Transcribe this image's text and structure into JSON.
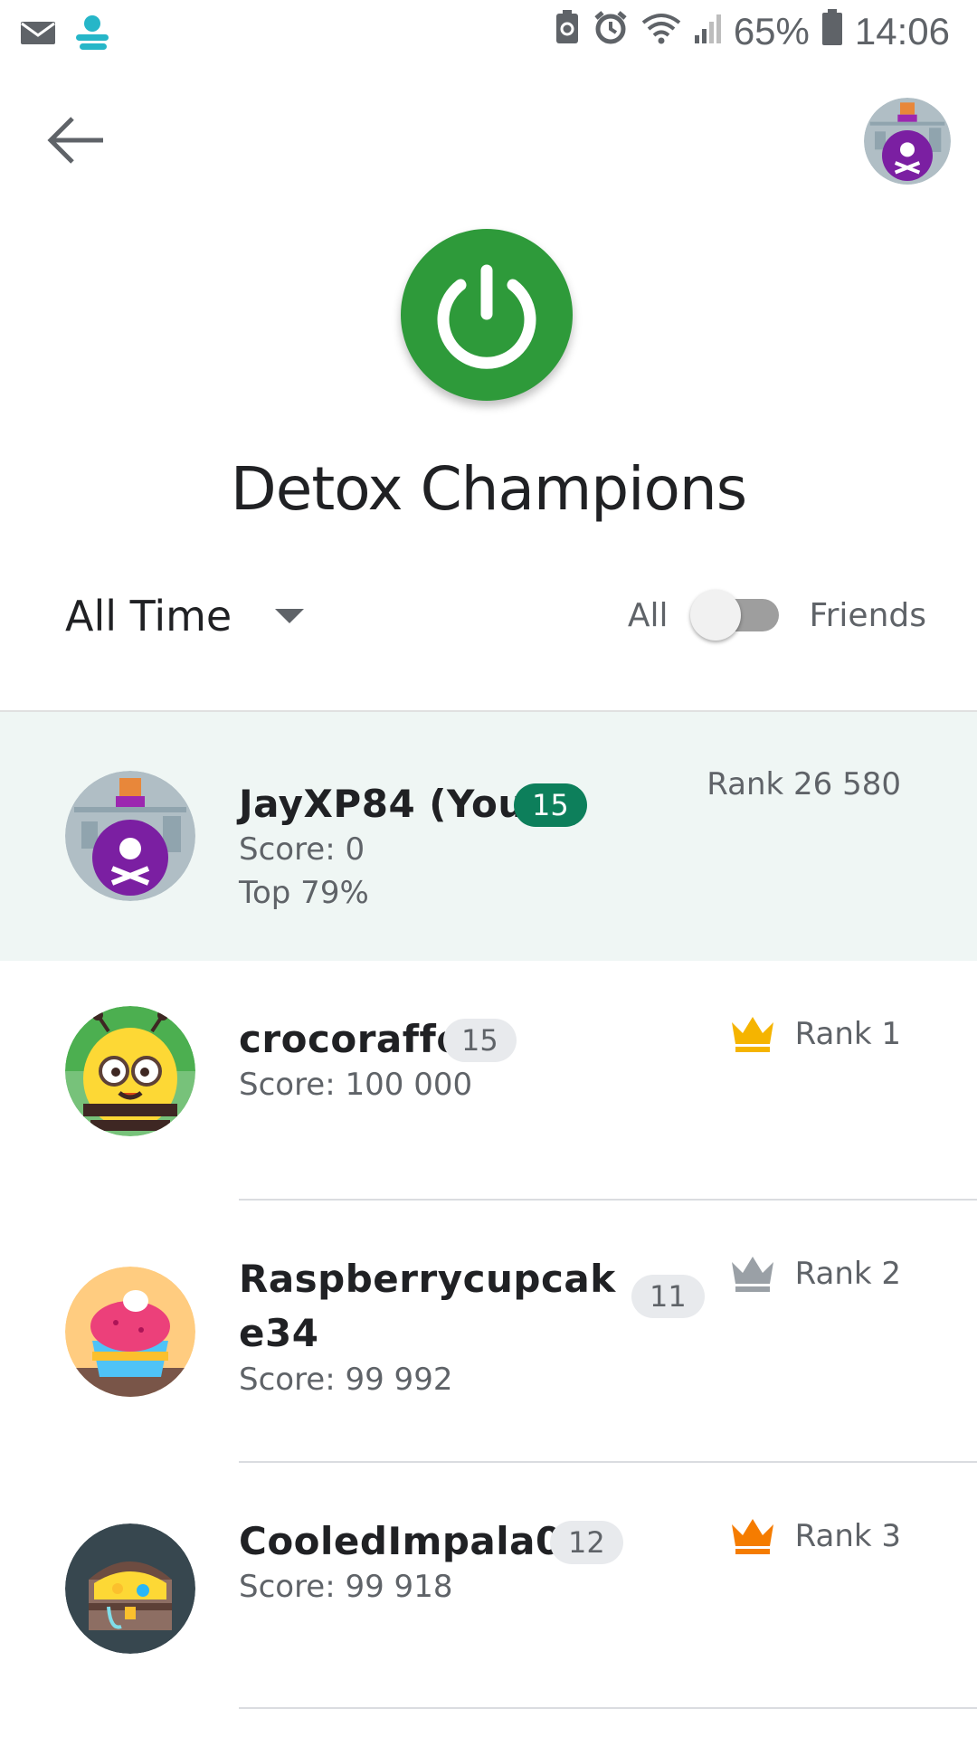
{
  "status_bar": {
    "battery": "65%",
    "time": "14:06"
  },
  "header": {
    "title": "Detox Champions"
  },
  "filters": {
    "period": "All Time",
    "toggle_left": "All",
    "toggle_right": "Friends",
    "toggle_on": false
  },
  "leaderboard": [
    {
      "name": "JayXP84 (You)",
      "level": "15",
      "score": "Score: 0",
      "extra": "Top 79%",
      "rank": "Rank 26 580",
      "avatar": "poison-bottle",
      "highlight": true
    },
    {
      "name": "crocoraffe",
      "level": "15",
      "score": "Score: 100 000",
      "rank": "Rank 1",
      "crown_color": "#f5b400",
      "avatar": "bee"
    },
    {
      "name_line1": "Raspberrycupcak",
      "name_line2": "e34",
      "level": "11",
      "score": "Score: 99 992",
      "rank": "Rank 2",
      "crown_color": "#9aa0a6",
      "avatar": "cupcake"
    },
    {
      "name": "CooledImpala05",
      "level": "12",
      "score": "Score: 99 918",
      "rank": "Rank 3",
      "crown_color": "#f57c00",
      "avatar": "treasure-chest"
    }
  ],
  "colors": {
    "power_button": "#2e9a3a",
    "level_badge_you": "#0d7f5b",
    "highlight_row": "#eff6f4"
  }
}
